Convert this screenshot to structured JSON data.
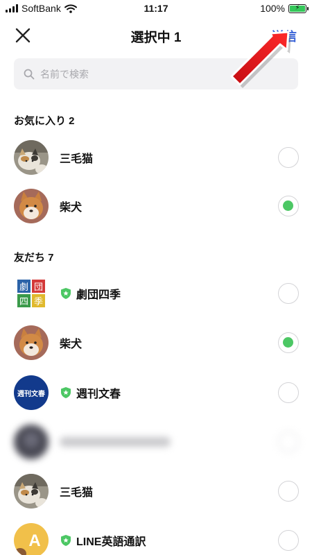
{
  "status": {
    "carrier": "SoftBank",
    "time": "11:17",
    "battery": "100%",
    "battery_level": 1.0
  },
  "header": {
    "title": "選択中 1",
    "send_label": "送信",
    "close_icon": "close-icon"
  },
  "search": {
    "placeholder": "名前で検索",
    "value": ""
  },
  "sections": [
    {
      "label": "お気に入り 2",
      "items": [
        {
          "name": "三毛猫",
          "avatar": "calico-cat-avatar",
          "official": false,
          "selected": false
        },
        {
          "name": "柴犬",
          "avatar": "shiba-dog-avatar",
          "official": false,
          "selected": true
        }
      ]
    },
    {
      "label": "友だち 7",
      "items": [
        {
          "name": "劇団四季",
          "avatar_text": [
            "劇",
            "団",
            "四",
            "季"
          ],
          "official": true,
          "selected": false
        },
        {
          "name": "柴犬",
          "avatar": "shiba-dog-avatar",
          "official": false,
          "selected": true
        },
        {
          "name": "週刊文春",
          "avatar_text": "週刊文春",
          "official": true,
          "selected": false
        },
        {
          "name": "",
          "avatar": "blurred-avatar",
          "official": false,
          "selected": false,
          "blurred": true
        },
        {
          "name": "三毛猫",
          "avatar": "calico-cat-avatar",
          "official": false,
          "selected": false
        },
        {
          "name": "LINE英語通訳",
          "avatar_text": "A",
          "official": true,
          "selected": false
        }
      ]
    }
  ],
  "colors": {
    "accent_blue": "#3a64d8",
    "check_green": "#4cc764",
    "official_badge": "#4cc764",
    "arrow_red": "#e8141a"
  }
}
